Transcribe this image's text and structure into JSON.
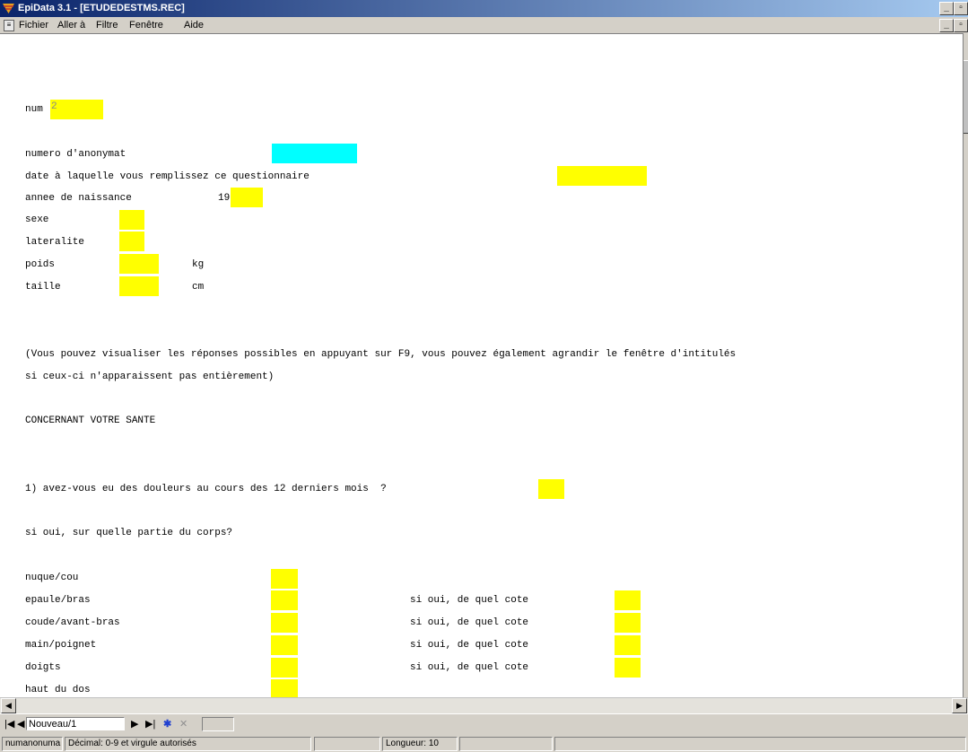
{
  "window": {
    "title": "EpiData 3.1 - [ETUDEDESTMS.REC]",
    "controls": [
      "_",
      "̅",
      "×"
    ]
  },
  "menu": {
    "items": [
      "Fichier",
      "Aller à",
      "Filtre",
      "Fenêtre",
      "Aide"
    ]
  },
  "form": {
    "num": {
      "label": "num",
      "value": "2"
    },
    "anonymat": {
      "label": "numero d'anonymat"
    },
    "date": {
      "label": "date à laquelle vous remplissez ce questionnaire"
    },
    "naissance": {
      "label": "annee de naissance",
      "prefix": "19"
    },
    "sexe": {
      "label": "sexe"
    },
    "lateralite": {
      "label": "lateralite"
    },
    "poids": {
      "label": "poids",
      "unit": "kg"
    },
    "taille": {
      "label": "taille",
      "unit": "cm"
    },
    "info_line1": "(Vous pouvez visualiser les réponses possibles en appuyant sur F9, vous pouvez également agrandir le fenêtre d'intitulés",
    "info_line2": "si ceux-ci n'apparaissent pas entièrement)",
    "section": "CONCERNANT VOTRE SANTE",
    "q1": "1) avez-vous eu des douleurs au cours des 12 derniers mois  ?",
    "q1b": "si oui, sur quelle partie du corps?",
    "side_label": "si oui, de quel cote",
    "body_parts": {
      "nuque": "nuque/cou",
      "epaule": "epaule/bras",
      "coude": "coude/avant-bras",
      "main": "main/poignet",
      "doigts": "doigts",
      "haut_dos": "haut du dos"
    }
  },
  "nav": {
    "record": "Nouveau/1"
  },
  "status": {
    "field": "numanonuma",
    "hint": "Décimal: 0-9 et virgule autorisés",
    "empty": "",
    "length": "Longueur: 10"
  }
}
